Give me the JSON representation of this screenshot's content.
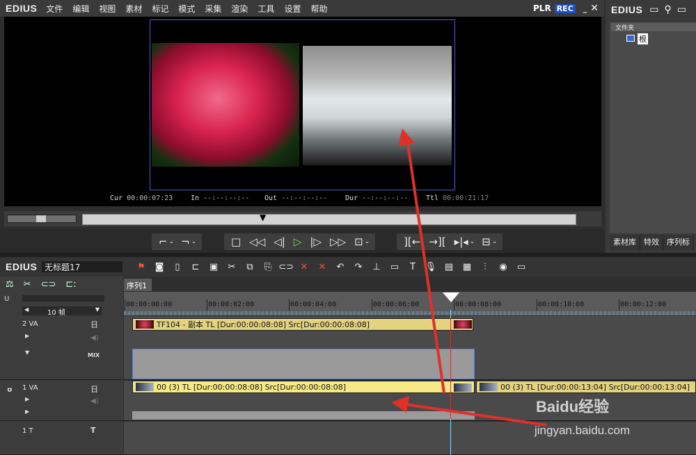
{
  "app": {
    "name": "EDIUS"
  },
  "menu": [
    "文件",
    "编辑",
    "视图",
    "素材",
    "标记",
    "模式",
    "采集",
    "渲染",
    "工具",
    "设置",
    "帮助"
  ],
  "player": {
    "plr_label": "PLR",
    "rec_label": "REC"
  },
  "timecodes": {
    "cur_label": "Cur",
    "cur_value": "00:00:07:23",
    "in_label": "In",
    "in_value": "--:--:--:--",
    "out_label": "Out",
    "out_value": "--:--:--:--",
    "dur_label": "Dur",
    "dur_value": "--:--:--:--",
    "ttl_label": "Ttl",
    "ttl_value": "00:00:21:17"
  },
  "right_panel": {
    "title": "EDIUS",
    "folder_header": "文件夹",
    "root_label": "根",
    "tabs": [
      "素材库",
      "特效",
      "序列标"
    ]
  },
  "timeline": {
    "project_name": "无标题17",
    "sequence_tab": "序列1",
    "zoom_label": "10 帧",
    "ruler_ticks": [
      "00:00:00:00",
      "00:00:02:00",
      "00:00:04:00",
      "00:00:06:00",
      "00:00:08:00",
      "00:00:10:00",
      "00:00:12:00"
    ],
    "tracks": [
      {
        "label": "2 VA",
        "mix_label": "MIX"
      },
      {
        "label": "1 VA"
      },
      {
        "label": "1 T"
      }
    ],
    "clips": {
      "va2_clip": "TF104 - 副本  TL [Dur:00:00:08:08]  Src[Dur:00:00:08:08]",
      "va1_clip": "00 (3)  TL [Dur:00:00:08:08]  Src[Dur:00:00:08:08]",
      "va1_clip2": "00 (3)  TL [Dur:00:00:13:04]  Src[Dur:00:00:13:04]"
    }
  },
  "watermark": {
    "brand": "Baidu经验",
    "url": "jingyan.baidu.com"
  },
  "colors": {
    "accent": "#1b4fc4",
    "clip_yellow": "#f2e27a",
    "playhead": "#7fe0ff",
    "annotation": "#e0302a"
  }
}
